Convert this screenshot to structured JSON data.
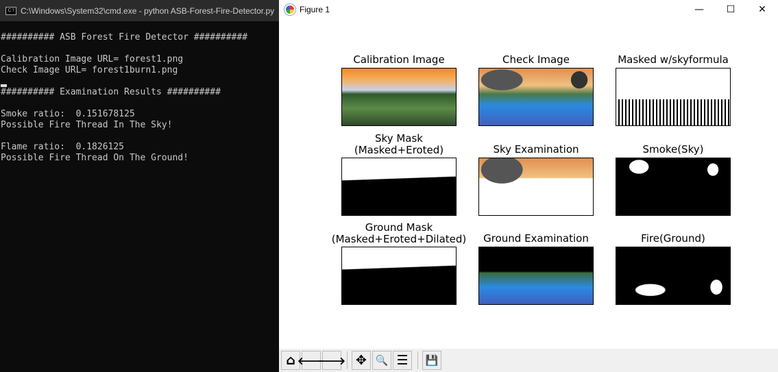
{
  "terminal": {
    "title": "C:\\Windows\\System32\\cmd.exe - python  ASB-Forest-Fire-Detector.py",
    "lines": [
      "########## ASB Forest Fire Detector ##########",
      "",
      "Calibration Image URL= forest1.png",
      "Check Image URL= forest1burn1.png",
      "",
      "########## Examination Results ##########",
      "",
      "Smoke ratio:  0.151678125",
      "Possible Fire Thread In The Sky!",
      "",
      "Flame ratio:  0.1826125",
      "Possible Fire Thread On The Ground!"
    ]
  },
  "figure": {
    "title": "Figure 1",
    "panels": [
      {
        "title": "Calibration Image",
        "kind": "forest-orange"
      },
      {
        "title": "Check Image",
        "kind": "forest-smoke"
      },
      {
        "title": "Masked w/skyformula",
        "kind": "mask-noise"
      },
      {
        "title": "Sky Mask\n(Masked+Eroted)",
        "kind": "sky-mask"
      },
      {
        "title": "Sky Examination",
        "kind": "sky-exam"
      },
      {
        "title": "Smoke(Sky)",
        "kind": "smoke"
      },
      {
        "title": "Ground Mask\n(Masked+Eroted+Dilated)",
        "kind": "sky-mask"
      },
      {
        "title": "Ground Examination",
        "kind": "ground-exam"
      },
      {
        "title": "Fire(Ground)",
        "kind": "fire"
      }
    ],
    "toolbar": [
      {
        "name": "home",
        "glyph": "⌂"
      },
      {
        "name": "back",
        "glyph": "🡐"
      },
      {
        "name": "forward",
        "glyph": "🡒"
      },
      {
        "name": "pan",
        "glyph": "✥"
      },
      {
        "name": "zoom",
        "glyph": "🔍"
      },
      {
        "name": "configure-subplots",
        "glyph": "☰"
      },
      {
        "name": "save",
        "glyph": "💾"
      }
    ]
  }
}
